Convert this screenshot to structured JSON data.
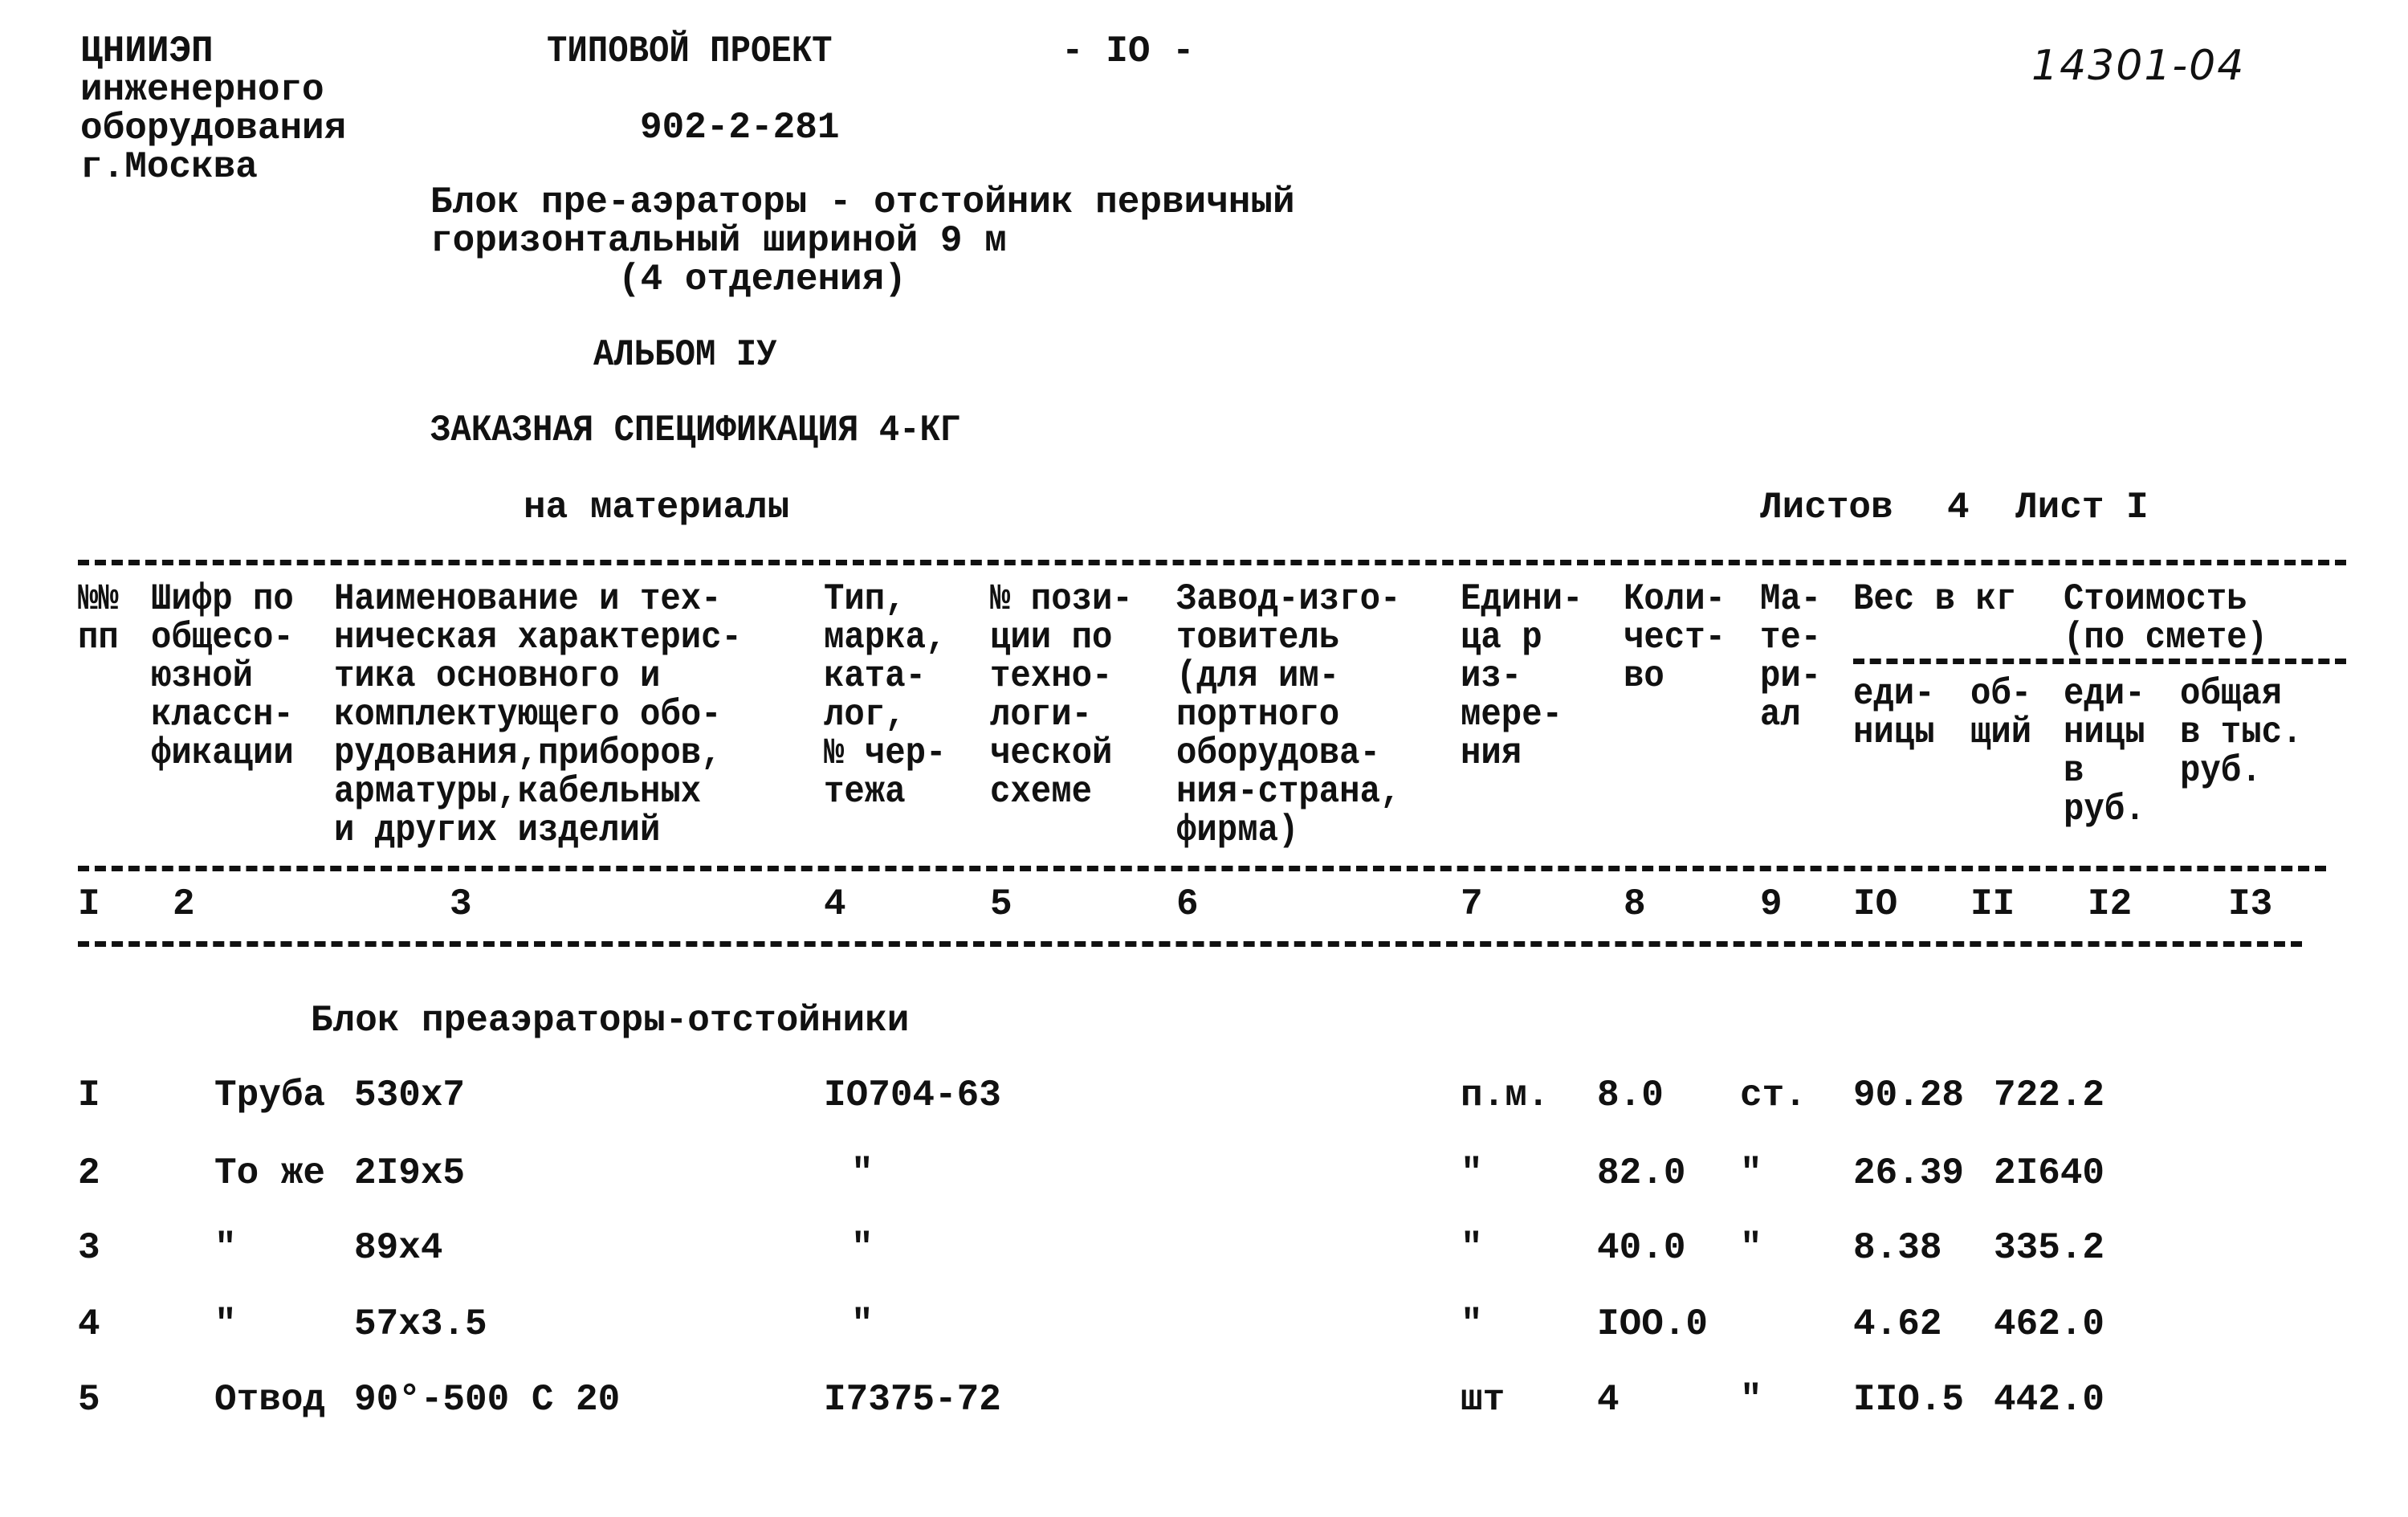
{
  "header": {
    "org_lines": "ЦНИИЭП\nинженерного\nоборудования\nг.Москва",
    "project_type": "ТИПОВОЙ ПРОЕКТ",
    "page": "- IO -",
    "project_number": "902-2-281",
    "inventory_number": "14301-04",
    "block_title": "Блок пре-аэраторы - отстойник первичный\nгоризонтальный шириной 9 м",
    "block_subtitle": "(4 отделения)",
    "album": "АЛЬБОМ IУ",
    "spec_title": "ЗАКАЗНАЯ СПЕЦИФИКАЦИЯ 4-КГ",
    "spec_subtitle": "на материалы",
    "sheets_label": "Листов",
    "sheets_count": "4",
    "sheet_label": "Лист I"
  },
  "table": {
    "columns": [
      "№№\nпп",
      "Шифр по\nобщесо-\nюзной\nклассн-\nфикации",
      "Наименование и тех-\nническая характерис-\nтика основного и\nкомплектующего обо-\nрудования,приборов,\nарматуры,кабельных\nи других изделий",
      "Тип,\nмарка,\nката-\nлог,\n№ чер-\nтежа",
      "№ пози-\nции по\nтехно-\nлоги-\nческой\nсхеме",
      "Завод-изго-\nтовитель\n(для им-\nпортного\nоборудова-\nния-страна,\nфирма)",
      "Едини-\nца р\nиз-\nмере-\nния",
      "Коли-\nчест-\nво",
      "Ма-\nте-\nри-\nал"
    ],
    "weight_group": "Вес в кг",
    "weight_sub": [
      "еди-\nницы",
      "об-\nщий"
    ],
    "cost_group": "Стоимость\n(по смете)",
    "cost_sub": [
      "еди-\nницы\nв\nруб.",
      "общая\nв тыс.\nруб."
    ],
    "column_numbers": [
      "I",
      "2",
      "3",
      "4",
      "5",
      "6",
      "7",
      "8",
      "9",
      "IO",
      "II",
      "I2",
      "I3"
    ],
    "section_title": "Блок преаэраторы-отстойники",
    "rows": [
      {
        "num": "I",
        "name": "Труба",
        "size": "530x7",
        "standard": "IO704-63",
        "unit": "п.м.",
        "qty": "8.0",
        "material": "ст.",
        "unit_weight": "90.28",
        "total_weight": "722.2"
      },
      {
        "num": "2",
        "name": "То же",
        "size": "2I9x5",
        "standard": "\"",
        "unit": "\"",
        "qty": "82.0",
        "material": "\"",
        "unit_weight": "26.39",
        "total_weight": "2I640"
      },
      {
        "num": "3",
        "name": "\"",
        "size": "89x4",
        "standard": "\"",
        "unit": "\"",
        "qty": "40.0",
        "material": "\"",
        "unit_weight": "8.38",
        "total_weight": "335.2"
      },
      {
        "num": "4",
        "name": "\"",
        "size": "57x3.5",
        "standard": "\"",
        "unit": "\"",
        "qty": "IOO.0",
        "material": "",
        "unit_weight": "4.62",
        "total_weight": "462.0"
      },
      {
        "num": "5",
        "name": "Отвод",
        "size": "90°-500 С 20",
        "standard": "I7375-72",
        "unit": "шт",
        "qty": "4",
        "material": "\"",
        "unit_weight": "IIO.5",
        "total_weight": "442.0"
      }
    ]
  }
}
